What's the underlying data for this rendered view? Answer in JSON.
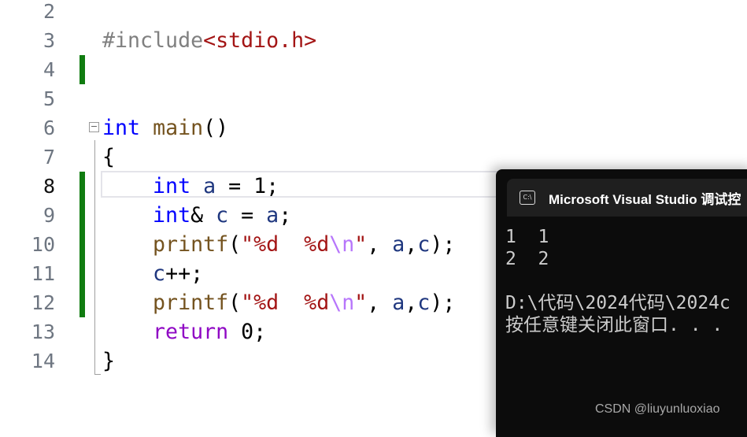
{
  "colors": {
    "keyword": "#0000ff",
    "function": "#74531f",
    "string": "#a31515",
    "escape": "#b776fb",
    "variable": "#1f377f",
    "macro": "#808080",
    "include": "#a31515",
    "control": "#8f08c4",
    "plain": "#000000",
    "change_bar": "#107c10"
  },
  "editor": {
    "current_line": "8",
    "lines": [
      {
        "n": "2",
        "tokens": []
      },
      {
        "n": "3",
        "tokens": [
          {
            "t": "#include",
            "c": "macro"
          },
          {
            "t": "<stdio.h>",
            "c": "include"
          }
        ]
      },
      {
        "n": "4",
        "tokens": []
      },
      {
        "n": "5",
        "tokens": []
      },
      {
        "n": "6",
        "tokens": [
          {
            "t": "int",
            "c": "keyword"
          },
          {
            "t": " ",
            "c": "plain"
          },
          {
            "t": "main",
            "c": "function"
          },
          {
            "t": "()",
            "c": "plain"
          }
        ]
      },
      {
        "n": "7",
        "tokens": [
          {
            "t": "{",
            "c": "plain"
          }
        ]
      },
      {
        "n": "8",
        "tokens": [
          {
            "t": "    int",
            "c": "keyword"
          },
          {
            "t": " ",
            "c": "plain"
          },
          {
            "t": "a",
            "c": "variable"
          },
          {
            "t": " = 1;",
            "c": "plain"
          }
        ]
      },
      {
        "n": "9",
        "tokens": [
          {
            "t": "    int",
            "c": "keyword"
          },
          {
            "t": "& ",
            "c": "plain"
          },
          {
            "t": "c",
            "c": "variable"
          },
          {
            "t": " = ",
            "c": "plain"
          },
          {
            "t": "a",
            "c": "variable"
          },
          {
            "t": ";",
            "c": "plain"
          }
        ]
      },
      {
        "n": "10",
        "tokens": [
          {
            "t": "    printf",
            "c": "function"
          },
          {
            "t": "(",
            "c": "plain"
          },
          {
            "t": "\"%d  %d",
            "c": "string"
          },
          {
            "t": "\\n",
            "c": "escape"
          },
          {
            "t": "\"",
            "c": "string"
          },
          {
            "t": ", ",
            "c": "plain"
          },
          {
            "t": "a",
            "c": "variable"
          },
          {
            "t": ",",
            "c": "plain"
          },
          {
            "t": "c",
            "c": "variable"
          },
          {
            "t": ");",
            "c": "plain"
          }
        ]
      },
      {
        "n": "11",
        "tokens": [
          {
            "t": "    c",
            "c": "variable"
          },
          {
            "t": "++;",
            "c": "plain"
          }
        ]
      },
      {
        "n": "12",
        "tokens": [
          {
            "t": "    printf",
            "c": "function"
          },
          {
            "t": "(",
            "c": "plain"
          },
          {
            "t": "\"%d  %d",
            "c": "string"
          },
          {
            "t": "\\n",
            "c": "escape"
          },
          {
            "t": "\"",
            "c": "string"
          },
          {
            "t": ", ",
            "c": "plain"
          },
          {
            "t": "a",
            "c": "variable"
          },
          {
            "t": ",",
            "c": "plain"
          },
          {
            "t": "c",
            "c": "variable"
          },
          {
            "t": ");",
            "c": "plain"
          }
        ]
      },
      {
        "n": "13",
        "tokens": [
          {
            "t": "    return",
            "c": "control"
          },
          {
            "t": " 0;",
            "c": "plain"
          }
        ]
      },
      {
        "n": "14",
        "tokens": [
          {
            "t": "}",
            "c": "plain"
          }
        ]
      }
    ],
    "changed_lines": [
      "4",
      "8",
      "9",
      "10",
      "11",
      "12"
    ],
    "fold_icon": "minus-box"
  },
  "console": {
    "title": "Microsoft Visual Studio 调试控",
    "icon": "console-icon",
    "icon_text": "C:\\",
    "output": "1  1\n2  2\n\nD:\\代码\\2024代码\\2024c\n按任意键关闭此窗口. . ."
  },
  "watermark": "CSDN @liuyunluoxiao"
}
